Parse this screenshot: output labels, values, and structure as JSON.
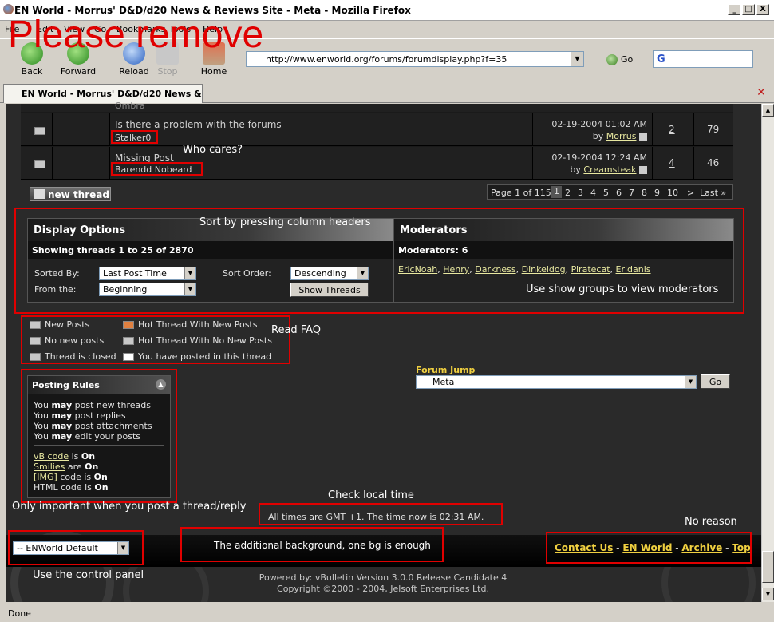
{
  "window": {
    "title": "EN World - Morrus' D&D/d20 News & Reviews Site - Meta - Mozilla Firefox",
    "controls": [
      "_",
      "□",
      "X"
    ]
  },
  "menu": [
    "File",
    "Edit",
    "View",
    "Go",
    "Bookmarks",
    "Tools",
    "Help"
  ],
  "toolbar": {
    "back": "Back",
    "forward": "Forward",
    "reload": "Reload",
    "stop": "Stop",
    "home": "Home",
    "url": "http://www.enworld.org/forums/forumdisplay.php?f=35",
    "go": "Go",
    "search_logo": "G"
  },
  "tab": {
    "label": "EN World - Morrus' D&D/d20 News & ..."
  },
  "threads": [
    {
      "partial": "Ombra",
      "date": "",
      "by": "",
      "author_link": "",
      "replies": "",
      "views": ""
    },
    {
      "title": "Is there a problem with the forums",
      "starter": "Stalker0",
      "date": "02-19-2004",
      "time": "01:02 AM",
      "by_prefix": "by",
      "last_poster": "Morrus",
      "replies": "2",
      "views": "79"
    },
    {
      "title": "Missing Post",
      "starter": "Barendd Nobeard",
      "date": "02-19-2004",
      "time": "12:24 AM",
      "by_prefix": "by",
      "last_poster": "Creamsteak",
      "replies": "4",
      "views": "46"
    }
  ],
  "new_thread_label": "new thread",
  "pager": {
    "label": "Page 1 of 115",
    "pages": [
      "1",
      "2",
      "3",
      "4",
      "5",
      "6",
      "7",
      "8",
      "9",
      "10"
    ],
    "next": ">",
    "last": "Last »"
  },
  "display_options": {
    "header": "Display Options",
    "showing": "Showing threads 1 to 25 of 2870",
    "sorted_by_label": "Sorted By:",
    "sorted_by_value": "Last Post Time",
    "from_label": "From the:",
    "from_value": "Beginning",
    "order_label": "Sort Order:",
    "order_value": "Descending",
    "show_threads": "Show Threads"
  },
  "moderators": {
    "header": "Moderators",
    "count": "Moderators: 6",
    "names": [
      "EricNoah",
      "Henry",
      "Darkness",
      "Dinkeldog",
      "Piratecat",
      "Eridanis"
    ]
  },
  "legend": {
    "new_posts": "New Posts",
    "no_new_posts": "No new posts",
    "closed": "Thread is closed",
    "hot_new": "Hot Thread With New Posts",
    "hot_no_new": "Hot Thread With No New Posts",
    "posted": "You have posted in this thread"
  },
  "posting_rules": {
    "header": "Posting Rules",
    "lines": [
      {
        "pre": "You ",
        "bold": "may",
        "post": " post new threads"
      },
      {
        "pre": "You ",
        "bold": "may",
        "post": " post replies"
      },
      {
        "pre": "You ",
        "bold": "may",
        "post": " post attachments"
      },
      {
        "pre": "You ",
        "bold": "may",
        "post": " edit your posts"
      }
    ],
    "codes": [
      {
        "link": "vB code",
        "mid": " is ",
        "state": "On"
      },
      {
        "link": "Smilies",
        "mid": " are ",
        "state": "On"
      },
      {
        "link": "[IMG]",
        "mid": " code is ",
        "state": "On"
      },
      {
        "link": "",
        "mid": "HTML code is ",
        "state": "On"
      }
    ]
  },
  "forum_jump": {
    "label": "Forum Jump",
    "value": "Meta",
    "go": "Go"
  },
  "time_notice": "All times are GMT +1. The time now is 02:31 AM.",
  "style_select": "-- ENWorld Default",
  "footer_links": [
    "Contact Us",
    "EN World",
    "Archive",
    "Top"
  ],
  "footer_sep": " - ",
  "powered_by": "Powered by: vBulletin Version 3.0.0 Release Candidate 4",
  "copyright": "Copyright ©2000 - 2004, Jelsoft Enterprises Ltd.",
  "status": "Done",
  "annotations": {
    "please_remove": "Please remove",
    "who_cares": "Who cares?",
    "sort_headers": "Sort by pressing column headers",
    "show_groups": "Use show groups to view moderators",
    "read_faq": "Read FAQ",
    "only_important": "Only important when you post a thread/reply",
    "check_time": "Check local time",
    "no_reason": "No reason",
    "additional_bg": "The additional background, one bg is enough",
    "control_panel": "Use the control panel"
  },
  "colors": {
    "annotation_red": "#e00000",
    "link_yellow": "#f0d040",
    "page_bg": "#2a2a2a"
  }
}
